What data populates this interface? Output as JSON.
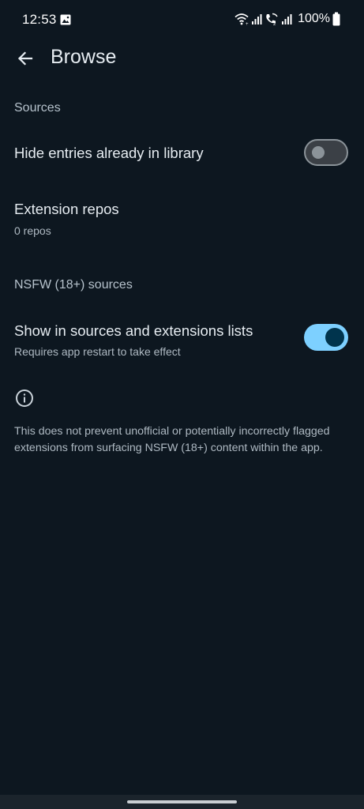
{
  "status_bar": {
    "time": "12:53",
    "battery": "100%",
    "icons": [
      "gallery-icon",
      "wifi-icon",
      "signal-icon",
      "wifi-call-icon",
      "signal-icon",
      "battery-icon"
    ]
  },
  "header": {
    "title": "Browse",
    "back_icon": "arrow-left-icon"
  },
  "sections": {
    "sources": {
      "header": "Sources",
      "hide_entries": {
        "title": "Hide entries already in library",
        "enabled": false
      },
      "extension_repos": {
        "title": "Extension repos",
        "subtitle": "0 repos"
      }
    },
    "nsfw": {
      "header": "NSFW (18+) sources",
      "show_in_lists": {
        "title": "Show in sources and extensions lists",
        "subtitle": "Requires app restart to take effect",
        "enabled": true
      },
      "info_text": "This does not prevent unofficial or potentially incorrectly flagged extensions from surfacing NSFW (18+) content within the app."
    }
  },
  "colors": {
    "background": "#0d1720",
    "switch_on": "#7dd0ff",
    "switch_on_knob": "#00344d",
    "switch_off": "#3b4046"
  }
}
